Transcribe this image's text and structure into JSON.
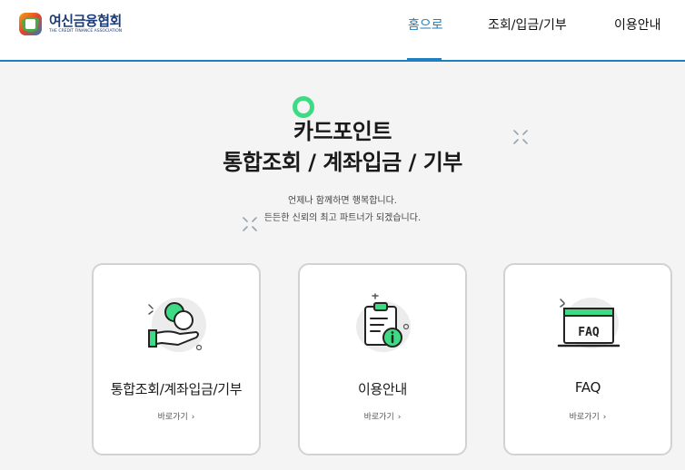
{
  "header": {
    "logo": {
      "name_ko": "여신금융협회",
      "name_en": "THE CREDIT FINANCE ASSOCIATION"
    },
    "nav": [
      {
        "label": "홈으로",
        "active": true
      },
      {
        "label": "조회/입금/기부",
        "active": false
      },
      {
        "label": "이용안내",
        "active": false
      }
    ],
    "accent_color": "#1f7fc0"
  },
  "hero": {
    "title_line1": "카드포인트",
    "title_line2": "통합조회 / 계좌입금 / 기부",
    "subtitle_line1": "언제나 함께하면 행복합니다.",
    "subtitle_line2": "든든한 신뢰의 최고 파트너가 되겠습니다."
  },
  "cards": [
    {
      "title": "통합조회/계좌입금/기부",
      "link_label": "바로가기",
      "icon": "hand-coin-icon"
    },
    {
      "title": "이용안내",
      "link_label": "바로가기",
      "icon": "clipboard-info-icon"
    },
    {
      "title": "FAQ",
      "link_label": "바로가기",
      "icon": "faq-screen-icon"
    }
  ],
  "faq_icon_text": "FAQ",
  "colors": {
    "accent_green": "#3ddc84",
    "text_dark": "#1a1a1a"
  }
}
